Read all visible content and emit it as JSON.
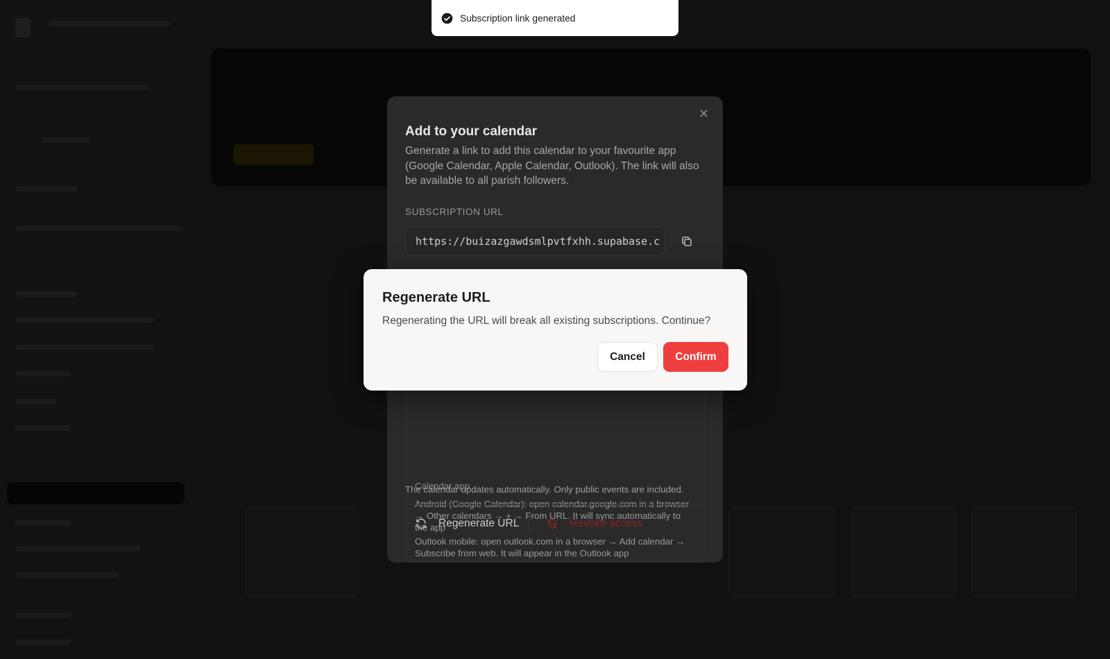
{
  "toast": {
    "message": "Subscription link generated",
    "icon": "check-circle-icon"
  },
  "calendar_dialog": {
    "title": "Add to your calendar",
    "description": "Generate a link to add this calendar to your favourite app (Google Calendar, Apple Calendar, Outlook). The link will also be available to all parish followers.",
    "url_label": "SUBSCRIPTION URL",
    "url_value": "https://buizazgawdsmlpvtfxhh.supabase.c",
    "help_heading_partial": "Calendar app",
    "help_android": "Android (Google Calendar): open calendar.google.com in a browser → Other calendars → + → From URL. It will sync automatically to the app",
    "help_outlook": "Outlook mobile: open outlook.com in a browser → Add calendar → Subscribe from web. It will appear in the Outlook app",
    "note": "The calendar updates automatically. Only public events are included.",
    "regenerate_label": "Regenerate URL",
    "revoke_label": "Revoke access"
  },
  "confirm_dialog": {
    "title": "Regenerate URL",
    "message": "Regenerating the URL will break all existing subscriptions. Continue?",
    "cancel_label": "Cancel",
    "confirm_label": "Confirm"
  },
  "colors": {
    "confirm": "#ef3e3e",
    "revoke": "#8a2525"
  }
}
